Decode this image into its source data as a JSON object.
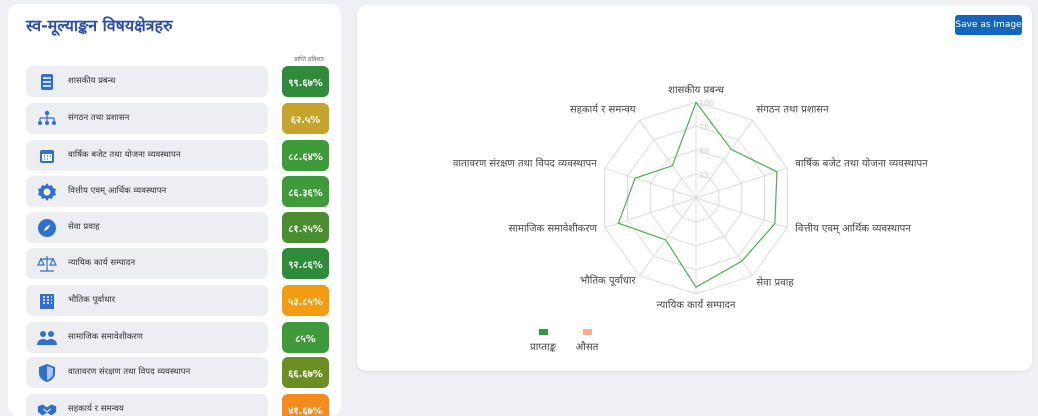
{
  "panel_title": "स्व-मूल्याङ्कन विषयक्षेत्रहरु",
  "column_header": "प्राप्ति प्रतिशत",
  "colors": {
    "green": "#2e8b3a",
    "olive": "#6b8e23",
    "gold": "#c6a32a",
    "orange": "#f39c12",
    "title": "#2f4fa2",
    "button": "#1565c0",
    "line": "#4caf50",
    "avg": "#f4b183"
  },
  "items": [
    {
      "label": "शासकीय प्रबन्ध",
      "score": "९९.६७%",
      "icon": "checklist-icon",
      "color": "#2e8b3a"
    },
    {
      "label": "संगठन तथा प्रशासन",
      "score": "६२.५%",
      "icon": "org-chart-icon",
      "color": "#c6a32a"
    },
    {
      "label": "वार्षिक बजेट तथा योजना व्यवस्थापन",
      "score": "८८.६४%",
      "icon": "calendar-icon",
      "color": "#3f9a3a"
    },
    {
      "label": "वित्तीय एवम् आर्थिक व्यवस्थापन",
      "score": "८६.३६%",
      "icon": "gear-icon",
      "color": "#3f9a3a"
    },
    {
      "label": "सेवा प्रवाह",
      "score": "८१.२५%",
      "icon": "compass-icon",
      "color": "#4a8f2f"
    },
    {
      "label": "न्यायिक कार्य सम्पादन",
      "score": "९२.८६%",
      "icon": "scales-icon",
      "color": "#2e8b3a"
    },
    {
      "label": "भौतिक पूर्वाधार",
      "score": "५३.८५%",
      "icon": "building-icon",
      "color": "#f39c12"
    },
    {
      "label": "सामाजिक समावेशीकरण",
      "score": "८५%",
      "icon": "people-icon",
      "color": "#3f9a3a"
    },
    {
      "label": "वातावरण संरक्षण तथा विपद व्यवस्थापन",
      "score": "६६.६७%",
      "icon": "shield-icon",
      "color": "#6b8e23"
    },
    {
      "label": "सहकार्य र समन्वय",
      "score": "४१.६७%",
      "icon": "handshake-icon",
      "color": "#f58a1f"
    }
  ],
  "save_button": "Save as Image",
  "chart_data": {
    "type": "radar",
    "categories": [
      "शासकीय प्रबन्ध",
      "संगठन तथा प्रशासन",
      "वार्षिक बजेट तथा योजना व्यवस्थापन",
      "वित्तीय एवम् आर्थिक व्यवस्थापन",
      "सेवा प्रवाह",
      "न्यायिक कार्य सम्पादन",
      "भौतिक पूर्वाधार",
      "सामाजिक समावेशीकरण",
      "वातावरण संरक्षण तथा विपद व्यवस्थापन",
      "सहकार्य र समन्वय"
    ],
    "series": [
      {
        "name": "प्राप्ताङ्क",
        "values": [
          99.67,
          62.5,
          88.64,
          86.36,
          81.25,
          92.86,
          53.85,
          85,
          66.67,
          41.67
        ],
        "color": "#4caf50"
      },
      {
        "name": "औसत",
        "values": [],
        "color": "#f4b183"
      }
    ],
    "ticks": [
      "25",
      "50",
      "75",
      "100"
    ],
    "rlim": [
      0,
      100
    ],
    "legend": "bottom-left"
  }
}
